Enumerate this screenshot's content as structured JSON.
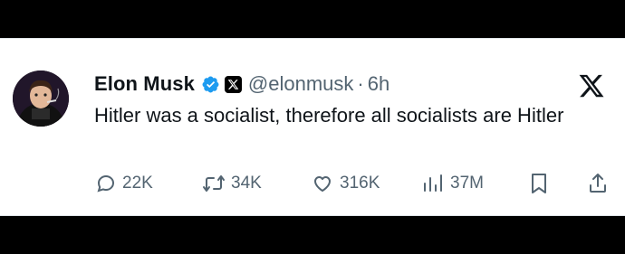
{
  "author": {
    "name": "Elon Musk",
    "handle": "@elonmusk",
    "separator": "·",
    "time": "6h"
  },
  "tweet": {
    "text": "Hitler was a socialist, therefore all socialists are Hitler"
  },
  "actions": {
    "replies": "22K",
    "reposts": "34K",
    "likes": "316K",
    "views": "37M"
  },
  "icons": {
    "verified": "verified-check-icon",
    "affiliate": "x-affiliate-badge-icon",
    "platform": "x-logo-icon",
    "reply": "reply-icon",
    "repost": "repost-icon",
    "like": "heart-icon",
    "views": "views-chart-icon",
    "bookmark": "bookmark-icon",
    "share": "share-icon"
  },
  "colors": {
    "verified_blue": "#1d9bf0",
    "text_primary": "#0f1419",
    "text_secondary": "#536471",
    "background": "#000000",
    "card": "#ffffff"
  }
}
